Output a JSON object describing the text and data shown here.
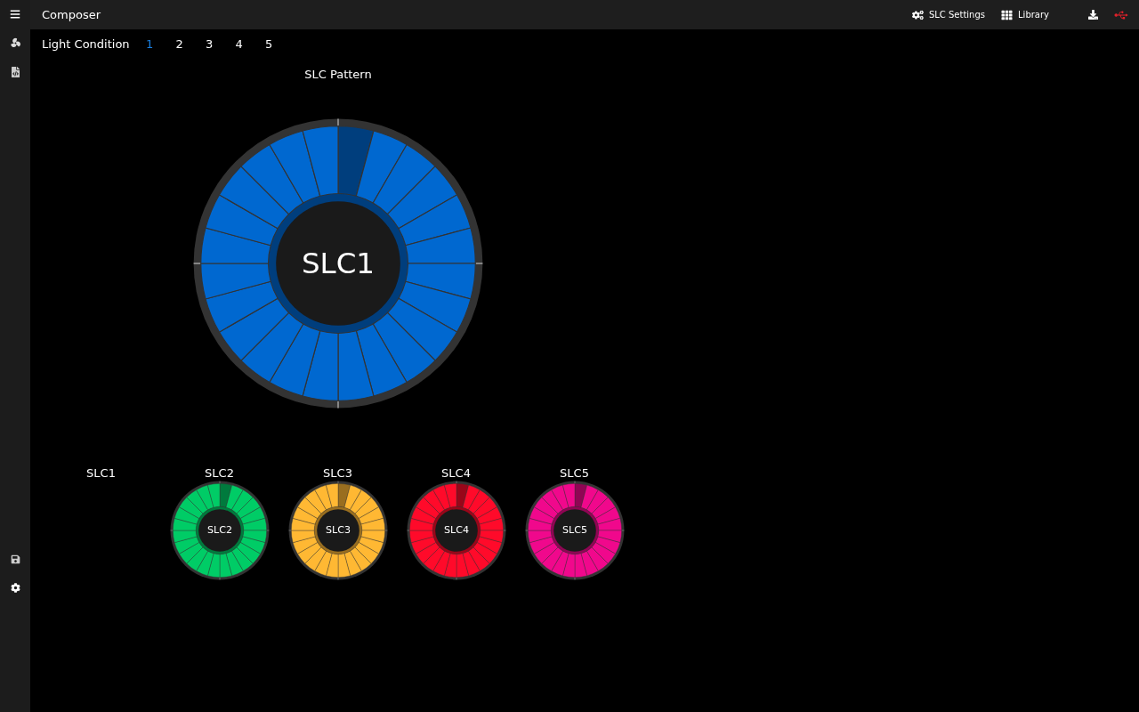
{
  "header": {
    "title": "Composer",
    "actions": [
      {
        "kind": "settings",
        "label": "SLC Settings"
      },
      {
        "kind": "library",
        "label": "Library"
      }
    ]
  },
  "light_condition": {
    "label": "Light Condition",
    "tabs": [
      {
        "label": "1",
        "selected": true
      },
      {
        "label": "2",
        "selected": false
      },
      {
        "label": "3",
        "selected": false
      },
      {
        "label": "4",
        "selected": false
      },
      {
        "label": "5",
        "selected": false
      }
    ]
  },
  "pattern": {
    "title": "SLC Pattern",
    "label": "SLC1",
    "color": "#0068d0",
    "segments": [
      {
        "selected": true
      },
      {
        "selected": false
      },
      {
        "selected": false
      },
      {
        "selected": false
      },
      {
        "selected": false
      },
      {
        "selected": false
      },
      {
        "selected": false
      },
      {
        "selected": false
      },
      {
        "selected": false
      },
      {
        "selected": false
      },
      {
        "selected": false
      },
      {
        "selected": false
      },
      {
        "selected": false
      },
      {
        "selected": false
      },
      {
        "selected": false
      },
      {
        "selected": false
      },
      {
        "selected": false
      },
      {
        "selected": false
      },
      {
        "selected": false
      },
      {
        "selected": false
      },
      {
        "selected": false
      },
      {
        "selected": false
      },
      {
        "selected": false
      },
      {
        "selected": false
      }
    ]
  },
  "thumbnails": [
    {
      "kind": "label",
      "title": "SLC1"
    },
    {
      "kind": "wheel",
      "title": "SLC2",
      "label": "SLC2",
      "color": "#00cc66",
      "segments": [
        {
          "selected": true
        },
        {
          "selected": false
        },
        {
          "selected": false
        },
        {
          "selected": false
        },
        {
          "selected": false
        },
        {
          "selected": false
        },
        {
          "selected": false
        },
        {
          "selected": false
        },
        {
          "selected": false
        },
        {
          "selected": false
        },
        {
          "selected": false
        },
        {
          "selected": false
        },
        {
          "selected": false
        },
        {
          "selected": false
        },
        {
          "selected": false
        },
        {
          "selected": false
        },
        {
          "selected": false
        },
        {
          "selected": false
        },
        {
          "selected": false
        },
        {
          "selected": false
        },
        {
          "selected": false
        },
        {
          "selected": false
        },
        {
          "selected": false
        },
        {
          "selected": false
        }
      ]
    },
    {
      "kind": "wheel",
      "title": "SLC3",
      "label": "SLC3",
      "color": "#ffb833",
      "segments": [
        {
          "selected": true
        },
        {
          "selected": false
        },
        {
          "selected": false
        },
        {
          "selected": false
        },
        {
          "selected": false
        },
        {
          "selected": false
        },
        {
          "selected": false
        },
        {
          "selected": false
        },
        {
          "selected": false
        },
        {
          "selected": false
        },
        {
          "selected": false
        },
        {
          "selected": false
        },
        {
          "selected": false
        },
        {
          "selected": false
        },
        {
          "selected": false
        },
        {
          "selected": false
        },
        {
          "selected": false
        },
        {
          "selected": false
        },
        {
          "selected": false
        },
        {
          "selected": false
        },
        {
          "selected": false
        },
        {
          "selected": false
        },
        {
          "selected": false
        },
        {
          "selected": false
        }
      ]
    },
    {
      "kind": "wheel",
      "title": "SLC4",
      "label": "SLC4",
      "color": "#ff0a2a",
      "segments": [
        {
          "selected": true
        },
        {
          "selected": false
        },
        {
          "selected": false
        },
        {
          "selected": false
        },
        {
          "selected": false
        },
        {
          "selected": false
        },
        {
          "selected": false
        },
        {
          "selected": false
        },
        {
          "selected": false
        },
        {
          "selected": false
        },
        {
          "selected": false
        },
        {
          "selected": false
        },
        {
          "selected": false
        },
        {
          "selected": false
        },
        {
          "selected": false
        },
        {
          "selected": false
        },
        {
          "selected": false
        },
        {
          "selected": false
        },
        {
          "selected": false
        },
        {
          "selected": false
        },
        {
          "selected": false
        },
        {
          "selected": false
        },
        {
          "selected": false
        },
        {
          "selected": false
        }
      ]
    },
    {
      "kind": "wheel",
      "title": "SLC5",
      "label": "SLC5",
      "color": "#f0088c",
      "segments": [
        {
          "selected": true
        },
        {
          "selected": false
        },
        {
          "selected": false
        },
        {
          "selected": false
        },
        {
          "selected": false
        },
        {
          "selected": false
        },
        {
          "selected": false
        },
        {
          "selected": false
        },
        {
          "selected": false
        },
        {
          "selected": false
        },
        {
          "selected": false
        },
        {
          "selected": false
        },
        {
          "selected": false
        },
        {
          "selected": false
        },
        {
          "selected": false
        },
        {
          "selected": false
        },
        {
          "selected": false
        },
        {
          "selected": false
        },
        {
          "selected": false
        },
        {
          "selected": false
        },
        {
          "selected": false
        },
        {
          "selected": false
        },
        {
          "selected": false
        },
        {
          "selected": false
        }
      ]
    }
  ]
}
